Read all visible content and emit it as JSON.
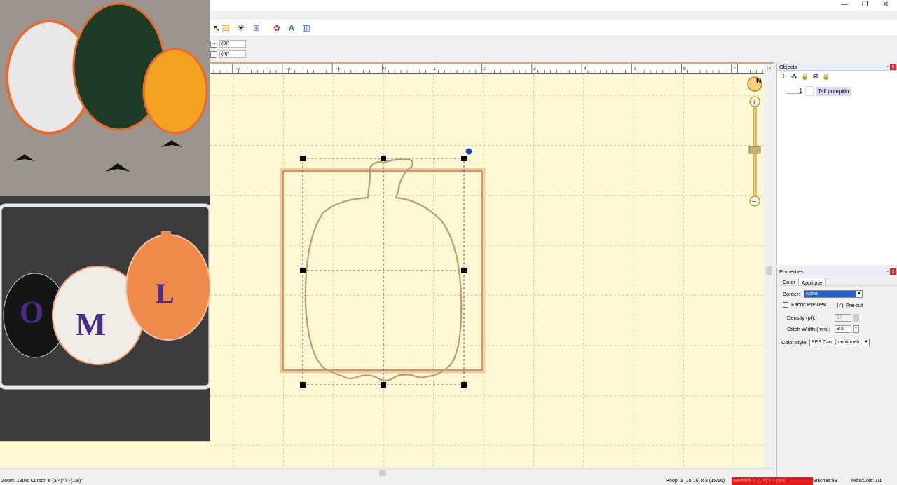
{
  "window": {
    "minimize": "—",
    "restore": "❐",
    "close": "✕"
  },
  "toolbar": {
    "buttons": [
      {
        "name": "select-tool-icon",
        "glyph": "↖"
      },
      {
        "name": "open-file-icon",
        "glyph": "▤"
      },
      {
        "name": "wand-tool-icon",
        "glyph": "✳"
      },
      {
        "name": "hoop-tool-icon",
        "glyph": "⊞"
      },
      {
        "name": "applique-tool-icon",
        "glyph": "✿"
      },
      {
        "name": "text-tool-icon",
        "glyph": "A"
      },
      {
        "name": "lettering-tool-icon",
        "glyph": "▥"
      }
    ]
  },
  "position": {
    "x_value": "(0)\"",
    "y_value": "(0)\""
  },
  "ruler": {
    "labels": [
      "-3",
      "-2",
      "-1",
      "0",
      "1",
      "2",
      "3",
      "4",
      "5",
      "6",
      "7"
    ],
    "arrow": "▷"
  },
  "compass": {
    "label": "N"
  },
  "zoom_controls": {
    "plus": "+",
    "minus": "−"
  },
  "objects_panel": {
    "title": "Objects",
    "pin": "▫",
    "close": "x",
    "tools": [
      "⁘",
      "⁂",
      "🔒",
      "⊠",
      "🔒"
    ],
    "items": [
      {
        "number": "1",
        "label": "Tall pumpkin"
      }
    ]
  },
  "properties_panel": {
    "title": "Properties",
    "pin": "▫",
    "close": "x",
    "tabs": [
      "Color",
      "Applique"
    ],
    "border_label": "Border:",
    "border_value": "None",
    "fabric_preview_label": "Fabric Preview",
    "precut_label": "Pre-cut",
    "density_label": "Density (pt):",
    "density_value": "17",
    "stitch_width_label": "Stitch Width (mm):",
    "stitch_width_value": "3.5",
    "color_style_label": "Color style:",
    "color_style_value": "PES Card (traditional)"
  },
  "status": {
    "zoom_cursor": "Zoom: 130%  Cursor: 6 (3/4)\" x -(1/8)\"",
    "hoop": "Hoop: 3 (15/16) x 3 (15/16)",
    "needed": "Needed: 3 (1/4) x 4 (5/8)",
    "stitches": "Stitches:89",
    "ndls": "Ndls/Cols: 1/1"
  },
  "colors": {
    "canvas": "#fef9d4",
    "accent": "#e3a070",
    "status_red": "#e31b1b"
  }
}
